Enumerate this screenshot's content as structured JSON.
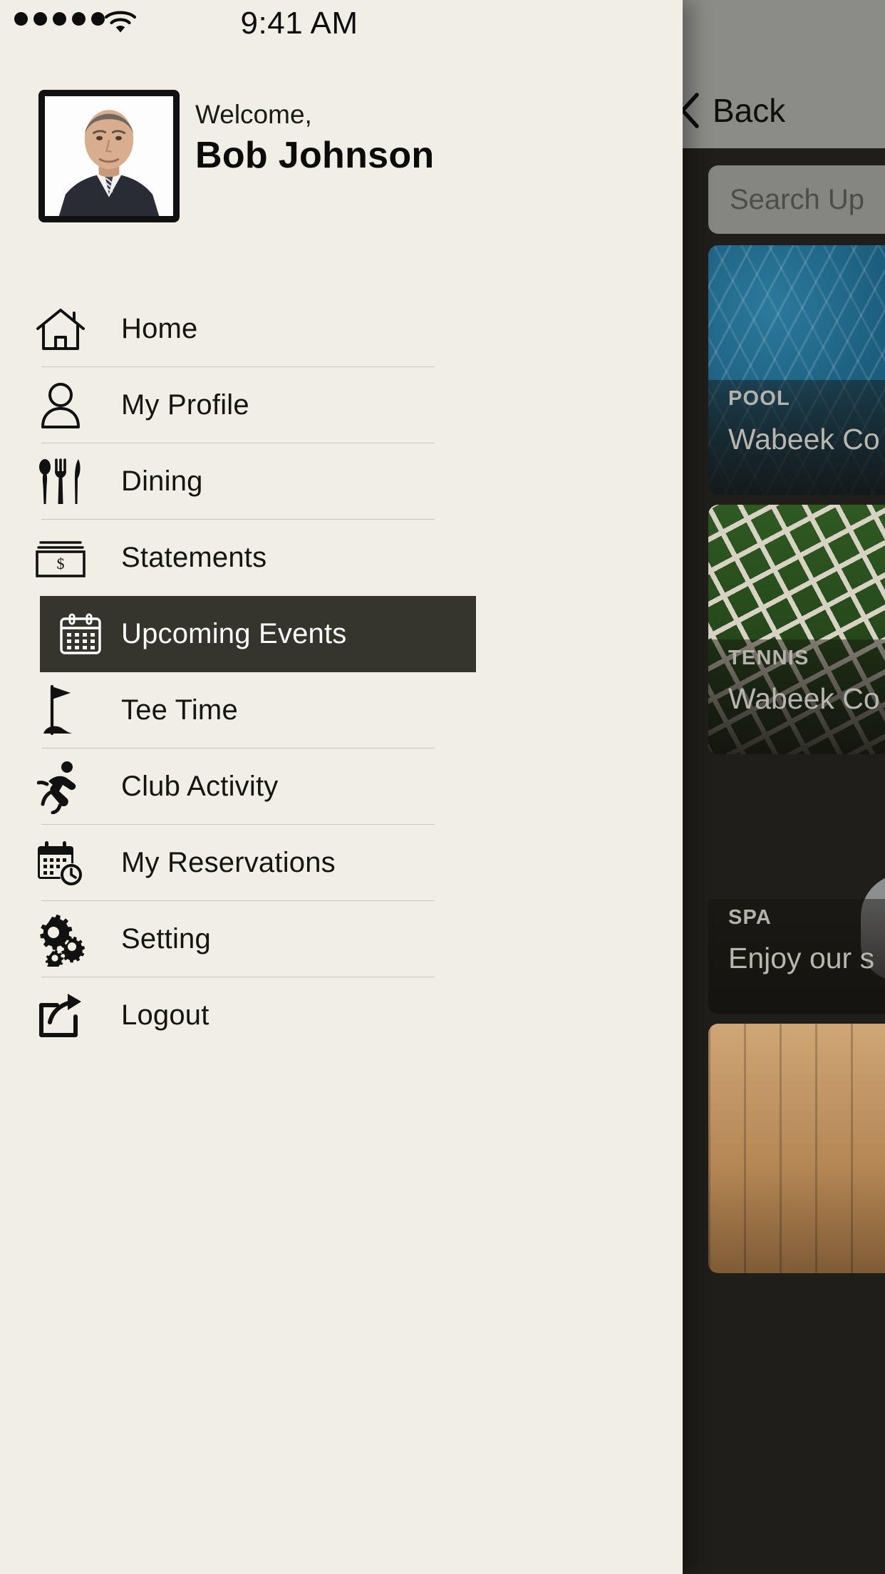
{
  "status_bar": {
    "signal_dots": 5,
    "wifi_icon": "wifi-icon",
    "time": "9:41 AM"
  },
  "profile": {
    "avatar_icon": "avatar-photo",
    "welcome_label": "Welcome,",
    "user_name": "Bob Johnson"
  },
  "menu": {
    "items": [
      {
        "label": "Home",
        "icon": "home-icon",
        "active": false
      },
      {
        "label": "My Profile",
        "icon": "user-icon",
        "active": false
      },
      {
        "label": "Dining",
        "icon": "cutlery-icon",
        "active": false
      },
      {
        "label": "Statements",
        "icon": "money-icon",
        "active": false
      },
      {
        "label": "Upcoming Events",
        "icon": "calendar-icon",
        "active": true
      },
      {
        "label": "Tee Time",
        "icon": "golf-flag-icon",
        "active": false
      },
      {
        "label": "Club Activity",
        "icon": "runner-icon",
        "active": false
      },
      {
        "label": "My Reservations",
        "icon": "calendar-clock-icon",
        "active": false
      },
      {
        "label": "Setting",
        "icon": "gears-icon",
        "active": false
      },
      {
        "label": "Logout",
        "icon": "logout-icon",
        "active": false
      }
    ]
  },
  "background_screen": {
    "back_label": "Back",
    "back_icon": "chevron-left-icon",
    "search_placeholder": "Search Up",
    "cards": [
      {
        "kicker": "POOL",
        "title": "Wabeek Co",
        "image": "pool-water-photo"
      },
      {
        "kicker": "TENNIS",
        "title": "Wabeek Co",
        "image": "tennis-net-photo"
      },
      {
        "kicker": "SPA",
        "title": "Enjoy our s",
        "image": "spa-sauna-photo"
      },
      {
        "kicker": "",
        "title": "",
        "image": "dining-table-photo"
      }
    ]
  },
  "colors": {
    "drawer_background": "#f1eee5",
    "active_item_background": "#35352e",
    "active_item_text": "#ffffff",
    "text_primary": "#15150f",
    "divider": "#c9c6ba",
    "background_header": "#8b8b88",
    "background_panel": "#1f1e1a"
  }
}
